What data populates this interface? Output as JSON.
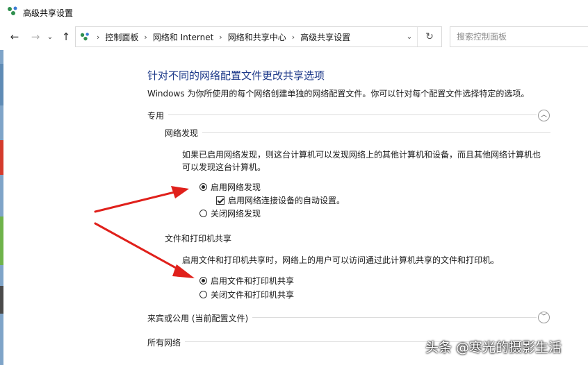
{
  "window": {
    "title": "高级共享设置"
  },
  "nav": {
    "breadcrumbs": [
      "控制面板",
      "网络和 Internet",
      "网络和共享中心",
      "高级共享设置"
    ],
    "search_placeholder": "搜索控制面板"
  },
  "content": {
    "heading": "针对不同的网络配置文件更改共享选项",
    "description": "Windows 为你所使用的每个网络创建单独的网络配置文件。你可以针对每个配置文件选择特定的选项。",
    "private_profile": {
      "title": "专用",
      "network_discovery": {
        "title": "网络发现",
        "description_line1": "如果已启用网络发现，则这台计算机可以发现网络上的其他计算机和设备，而且其他网络计算机也",
        "description_line2": "可以发现这台计算机。",
        "option_on": "启用网络发现",
        "option_auto_setup": "启用网络连接设备的自动设置。",
        "option_off": "关闭网络发现",
        "selected": "on",
        "auto_setup_checked": true
      },
      "file_printer_sharing": {
        "title": "文件和打印机共享",
        "description": "启用文件和打印机共享时，网络上的用户可以访问通过此计算机共享的文件和打印机。",
        "option_on": "启用文件和打印机共享",
        "option_off": "关闭文件和打印机共享",
        "selected": "on"
      }
    },
    "guest_public_profile": {
      "title": "来宾或公用 (当前配置文件)"
    },
    "all_networks": {
      "title": "所有网络"
    }
  },
  "watermark": "头条 @寒光的摄影生活",
  "colors": {
    "heading": "#1e3a8a",
    "arrow": "#e0201b"
  }
}
